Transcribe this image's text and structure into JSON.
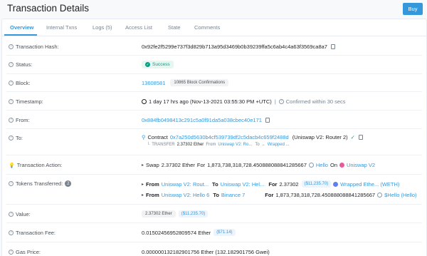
{
  "header": {
    "title": "Transaction Details",
    "buy_label": "Buy"
  },
  "tabs": [
    {
      "label": "Overview",
      "active": true
    },
    {
      "label": "Internal Txns",
      "active": false
    },
    {
      "label": "Logs (5)",
      "active": false
    },
    {
      "label": "Access List",
      "active": false
    },
    {
      "label": "State",
      "active": false
    },
    {
      "label": "Comments",
      "active": false
    }
  ],
  "fields": {
    "hash": {
      "label": "Transaction Hash:",
      "value": "0x92fe2f5299e737f3d829b713a95d3469b0b39239ffa5c6ab4c4a63f3569ca8a7"
    },
    "status": {
      "label": "Status:",
      "value": "Success"
    },
    "block": {
      "label": "Block:",
      "value": "13608581",
      "confirmations": "10865 Block Confirmations"
    },
    "timestamp": {
      "label": "Timestamp:",
      "value": "1 day 17 hrs ago (Nov-13-2021 03:55:30 PM +UTC)",
      "confirmed": "Confirmed within 30 secs"
    },
    "from": {
      "label": "From:",
      "value": "0x884fb0498413c291c5a0f91da5a038cbec40e171"
    },
    "to": {
      "label": "To:",
      "prefix": "Contract",
      "address": "0x7a250d5630b4cf539739df2c5dacb4c659f2488d",
      "name": "(Uniswap V2: Router 2)",
      "transfer_prefix": "TRANSFER",
      "transfer_amount": "2.37302 Ether",
      "transfer_from_word": "From",
      "transfer_from": "Uniswap V2: Ro...",
      "transfer_to_word": "To",
      "transfer_to": "Wrapped ..."
    },
    "action": {
      "label": "Transaction Action:",
      "swap_word": "Swap",
      "swap_amount": "2.37302 Ether",
      "for_word": "For",
      "for_amount": "1,873,738,318,728.450888088841285667",
      "token": "Hello",
      "on_word": "On",
      "exchange": "Uniswap V2"
    },
    "tokens": {
      "label": "Tokens Transferred:",
      "count": "2",
      "rows": [
        {
          "from_word": "From",
          "from": "Uniswap V2: Rout...",
          "to_word": "To",
          "to": "Uniswap V2: Hel...",
          "for_word": "For",
          "amount": "2.37302",
          "price": "($11,235.70)",
          "token": "Wrapped Ethe... (WETH)"
        },
        {
          "from_word": "From",
          "from": "Uniswap V2: Hello 6",
          "to_word": "To",
          "to": "Binance 7",
          "for_word": "For",
          "amount": "1,873,738,318,728.450888088841285667",
          "price": "",
          "token": "$Hello (Hello)"
        }
      ]
    },
    "value": {
      "label": "Value:",
      "value": "2.37302 Ether",
      "usd": "($11,235.70)"
    },
    "fee": {
      "label": "Transaction Fee:",
      "value": "0.01502456952809574 Ether",
      "usd": "($71.14)"
    },
    "gas": {
      "label": "Gas Price:",
      "value": "0.000000132182901756 Ether (132.182901756 Gwei)"
    }
  },
  "colors": {
    "accent": "#3498db",
    "success": "#00a186",
    "background": "#f8f9fa"
  }
}
